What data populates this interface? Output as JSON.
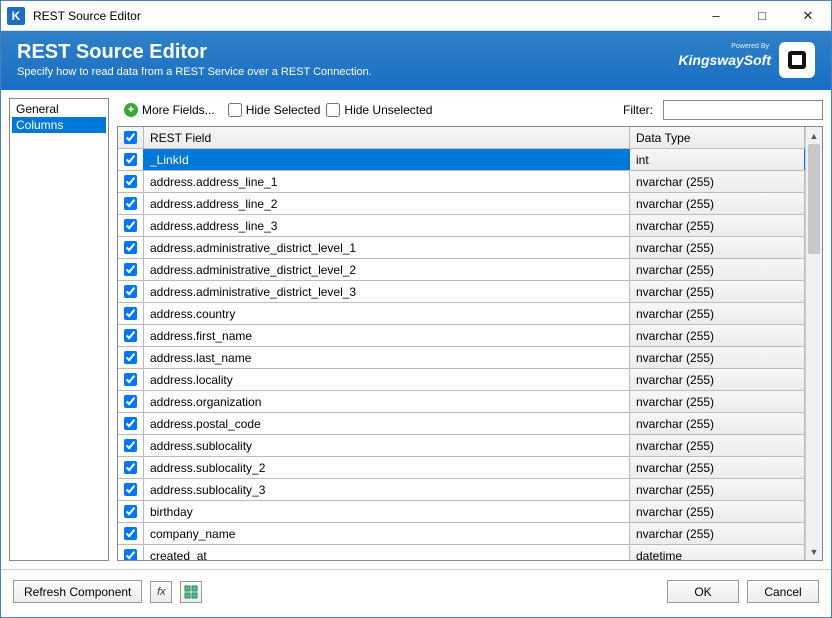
{
  "window": {
    "title": "REST Source Editor",
    "app_icon_letter": "K"
  },
  "banner": {
    "title": "REST Source Editor",
    "subtitle": "Specify how to read data from a REST Service over a REST Connection.",
    "powered_by": "Powered By",
    "brand": "KingswaySoft"
  },
  "nav": {
    "items": [
      {
        "label": "General",
        "selected": false
      },
      {
        "label": "Columns",
        "selected": true
      }
    ]
  },
  "toolbar": {
    "more_fields": "More Fields...",
    "hide_selected": "Hide Selected",
    "hide_unselected": "Hide Unselected",
    "filter_label": "Filter:",
    "filter_value": ""
  },
  "grid": {
    "headers": {
      "field": "REST Field",
      "type": "Data Type"
    },
    "rows": [
      {
        "field": "_LinkId",
        "type": "int",
        "checked": true,
        "selected": true
      },
      {
        "field": "address.address_line_1",
        "type": "nvarchar (255)",
        "checked": true
      },
      {
        "field": "address.address_line_2",
        "type": "nvarchar (255)",
        "checked": true
      },
      {
        "field": "address.address_line_3",
        "type": "nvarchar (255)",
        "checked": true
      },
      {
        "field": "address.administrative_district_level_1",
        "type": "nvarchar (255)",
        "checked": true
      },
      {
        "field": "address.administrative_district_level_2",
        "type": "nvarchar (255)",
        "checked": true
      },
      {
        "field": "address.administrative_district_level_3",
        "type": "nvarchar (255)",
        "checked": true
      },
      {
        "field": "address.country",
        "type": "nvarchar (255)",
        "checked": true
      },
      {
        "field": "address.first_name",
        "type": "nvarchar (255)",
        "checked": true
      },
      {
        "field": "address.last_name",
        "type": "nvarchar (255)",
        "checked": true
      },
      {
        "field": "address.locality",
        "type": "nvarchar (255)",
        "checked": true
      },
      {
        "field": "address.organization",
        "type": "nvarchar (255)",
        "checked": true
      },
      {
        "field": "address.postal_code",
        "type": "nvarchar (255)",
        "checked": true
      },
      {
        "field": "address.sublocality",
        "type": "nvarchar (255)",
        "checked": true
      },
      {
        "field": "address.sublocality_2",
        "type": "nvarchar (255)",
        "checked": true
      },
      {
        "field": "address.sublocality_3",
        "type": "nvarchar (255)",
        "checked": true
      },
      {
        "field": "birthday",
        "type": "nvarchar (255)",
        "checked": true
      },
      {
        "field": "company_name",
        "type": "nvarchar (255)",
        "checked": true
      },
      {
        "field": "created_at",
        "type": "datetime",
        "checked": true
      }
    ]
  },
  "footer": {
    "refresh": "Refresh Component",
    "ok": "OK",
    "cancel": "Cancel"
  }
}
